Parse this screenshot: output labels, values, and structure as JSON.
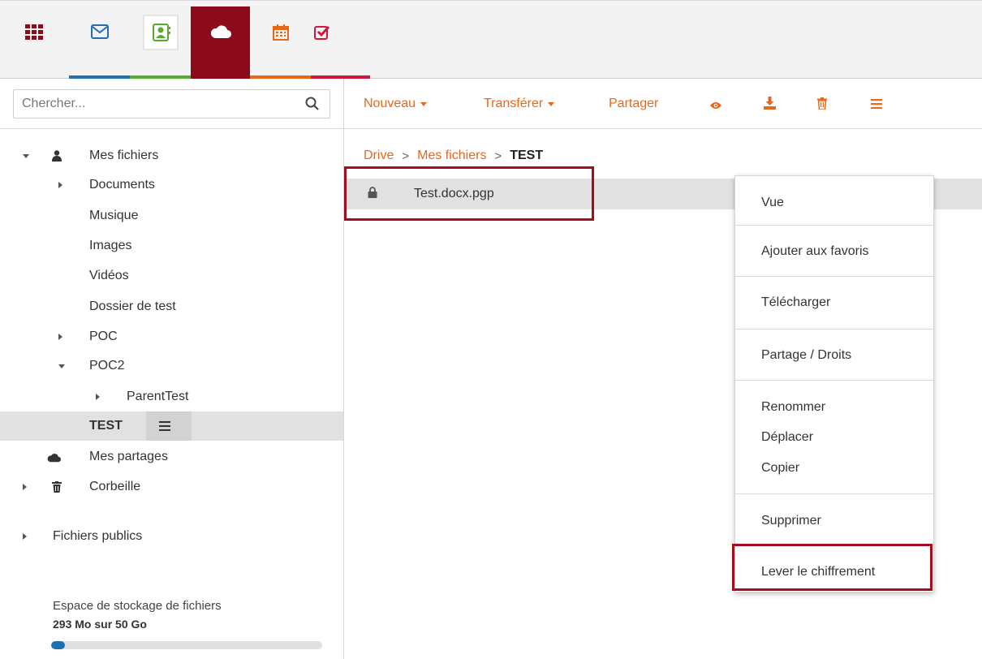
{
  "apps": [
    {
      "name": "apps-grid",
      "icon": "grid-icon",
      "color": "#8b0b1d"
    },
    {
      "name": "mail",
      "icon": "mail-icon",
      "color": "#1f6fb2"
    },
    {
      "name": "contacts",
      "icon": "contacts-icon",
      "color": "#5aab34"
    },
    {
      "name": "drive",
      "icon": "cloud-icon",
      "color": "#8b0b1d",
      "active": true
    },
    {
      "name": "calendar",
      "icon": "calendar-icon",
      "color": "#e8681a"
    },
    {
      "name": "tasks",
      "icon": "tasks-icon",
      "color": "#d0173a"
    }
  ],
  "search": {
    "placeholder": "Chercher...",
    "value": ""
  },
  "tree": {
    "my_files": "Mes fichiers",
    "documents": "Documents",
    "music": "Musique",
    "images": "Images",
    "videos": "Vidéos",
    "test_folder": "Dossier de test",
    "poc": "POC",
    "poc2": "POC2",
    "parent_test": "ParentTest",
    "test": "TEST",
    "my_shares": "Mes partages",
    "trash": "Corbeille",
    "public_files": "Fichiers publics"
  },
  "storage": {
    "label": "Espace de stockage de fichiers",
    "value": "293 Mo sur 50 Go",
    "fill_fraction": 0.05
  },
  "toolbar": {
    "new_label": "Nouveau",
    "transfer_label": "Transférer",
    "share_label": "Partager"
  },
  "breadcrumb": {
    "root": "Drive",
    "parent": "Mes fichiers",
    "current": "TEST",
    "separator": ">"
  },
  "file": {
    "name": "Test.docx.pgp",
    "icon": "lock-icon"
  },
  "context_menu": {
    "view": "Vue",
    "favorite": "Ajouter aux favoris",
    "download": "Télécharger",
    "share_rights": "Partage / Droits",
    "rename": "Renommer",
    "move": "Déplacer",
    "copy": "Copier",
    "delete": "Supprimer",
    "decrypt": "Lever le chiffrement"
  },
  "colors": {
    "accent": "#e8681a",
    "brand": "#8b0b1d",
    "highlight_box": "#a30e1e",
    "selection": "#e1e1e1"
  }
}
